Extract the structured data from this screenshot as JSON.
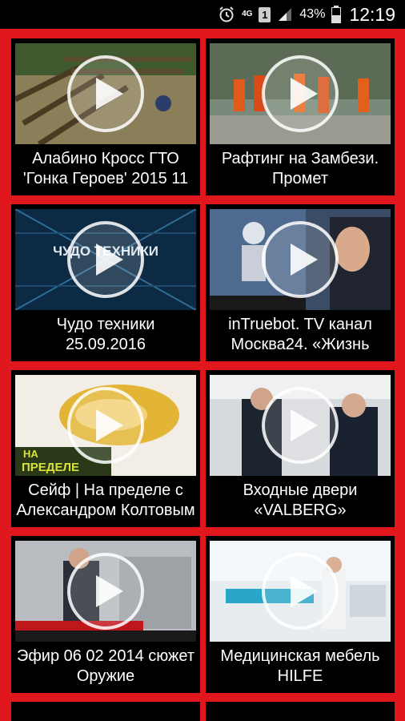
{
  "status_bar": {
    "network": "4G",
    "sim": "1",
    "battery_percent": "43%",
    "time": "12:19"
  },
  "videos": [
    {
      "line1": "Алабино  Кросс ГТО",
      "line2": "'Гонка Героев' 2015 11"
    },
    {
      "line1": "Рафтинг на Замбези.",
      "line2": "Промет"
    },
    {
      "line1": "Чудо техники",
      "line2": "25.09.2016"
    },
    {
      "line1": "inTruebot.   TV канал",
      "line2": "Москва24. «Жизнь"
    },
    {
      "line1": "Сейф | На пределе с",
      "line2": "Александром Колтовым"
    },
    {
      "line1": "Входные двери",
      "line2": "«VALBERG»"
    },
    {
      "line1": "Эфир 06 02 2014 сюжет",
      "line2": "Оружие"
    },
    {
      "line1": "Медицинская мебель",
      "line2": "HILFE"
    }
  ],
  "thumb_text": {
    "chudo": "ЧУДО ТЕХНИКИ",
    "napredele_1": "НА",
    "napredele_2": "ПРЕДЕЛЕ"
  }
}
